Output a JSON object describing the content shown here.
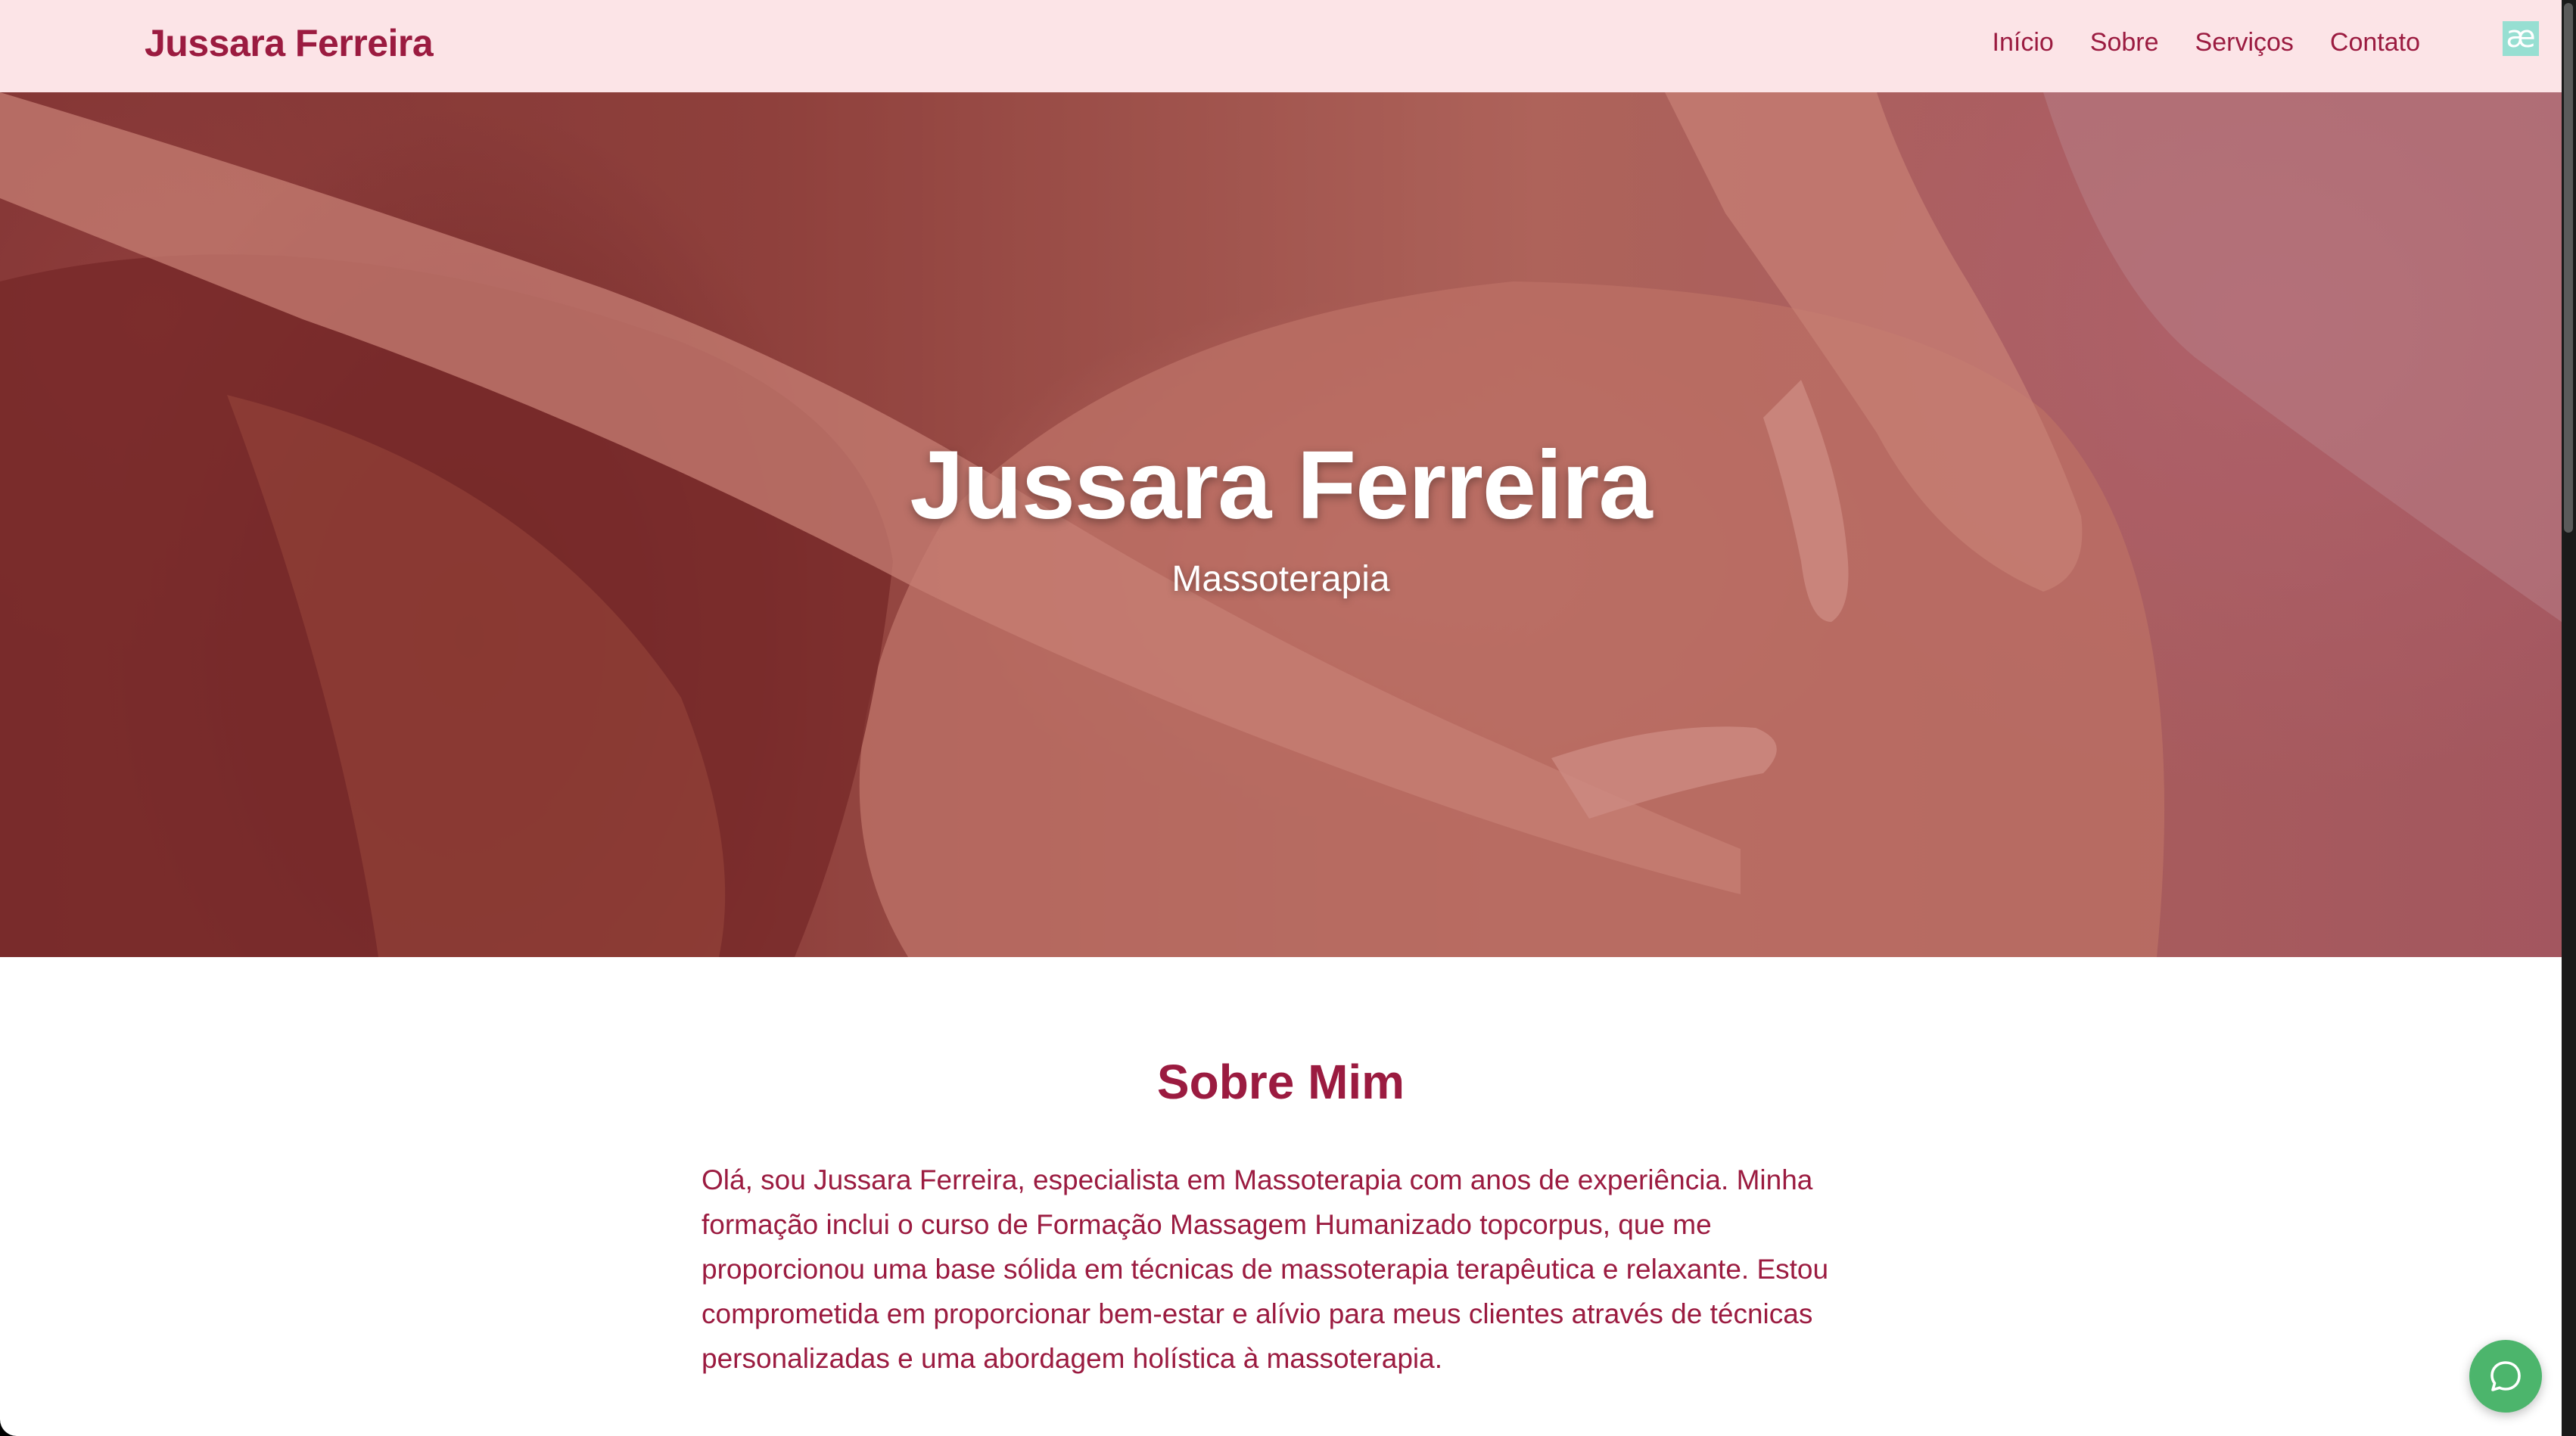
{
  "navbar": {
    "brand": "Jussara Ferreira",
    "links": [
      "Início",
      "Sobre",
      "Serviços",
      "Contato"
    ],
    "extension_badge": "æ",
    "background_color": "#fce4e7",
    "accent_color": "#9b1b40"
  },
  "hero": {
    "title": "Jussara Ferreira",
    "subtitle": "Massoterapia",
    "image": "massage-photo"
  },
  "about": {
    "title": "Sobre Mim",
    "text": "Olá, sou Jussara Ferreira, especialista em Massoterapia com anos de experiência. Minha formação inclui o curso de Formação Massagem Humanizado topcorpus, que me proporcionou uma base sólida em técnicas de massoterapia terapêutica e relaxante. Estou comprometida em proporcionar bem-estar e alívio para meus clientes através de técnicas personalizadas e uma abordagem holística à massoterapia."
  },
  "chat": {
    "icon": "chat-bubble-icon",
    "color": "#4cb56c"
  }
}
